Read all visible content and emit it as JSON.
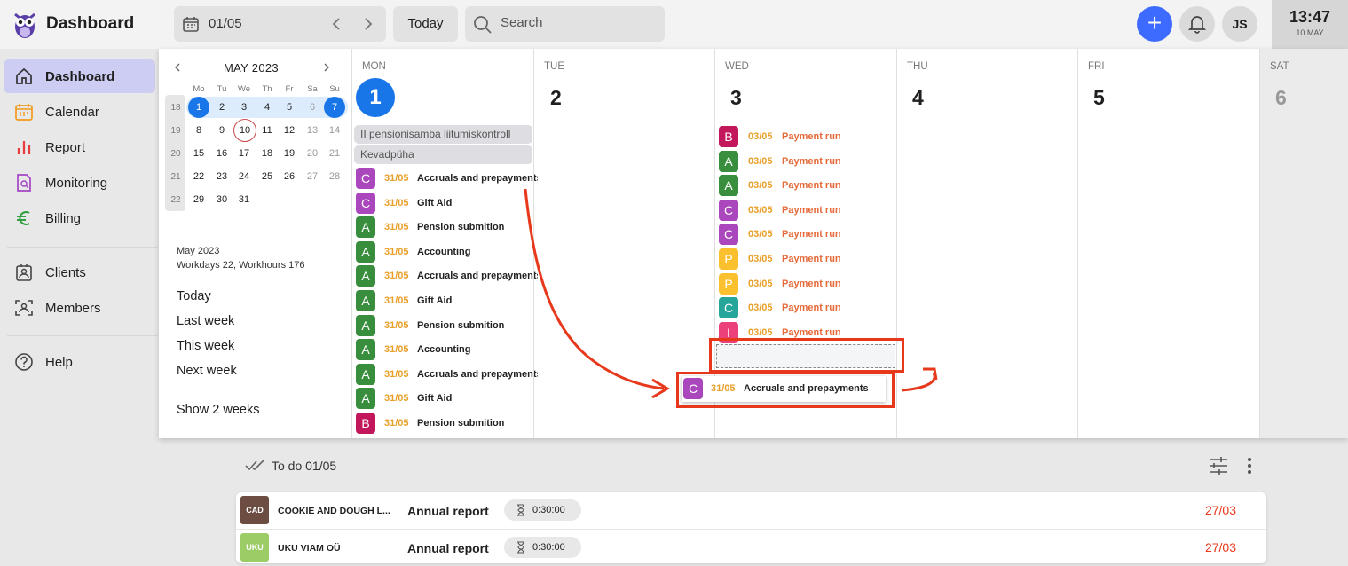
{
  "header": {
    "app_title": "Dashboard",
    "date_value": "01/05",
    "today_label": "Today",
    "search_placeholder": "Search",
    "avatar_initials": "JS",
    "clock_time": "13:47",
    "clock_date": "10 MAY"
  },
  "sidebar": {
    "items": [
      {
        "label": "Dashboard",
        "icon": "home-icon",
        "active": true
      },
      {
        "label": "Calendar",
        "icon": "calendar-icon"
      },
      {
        "label": "Report",
        "icon": "bar-chart-icon"
      },
      {
        "label": "Monitoring",
        "icon": "monitoring-doc-icon"
      },
      {
        "label": "Billing",
        "icon": "euro-icon"
      },
      {
        "label": "Clients",
        "icon": "clients-icon"
      },
      {
        "label": "Members",
        "icon": "members-icon"
      },
      {
        "label": "Help",
        "icon": "help-icon"
      }
    ]
  },
  "mini_calendar": {
    "title": "MAY 2023",
    "weekday_headers": [
      "Mo",
      "Tu",
      "We",
      "Th",
      "Fr",
      "Sa",
      "Su"
    ],
    "weeks": [
      {
        "week": "18",
        "days": [
          "1",
          "2",
          "3",
          "4",
          "5",
          "6",
          "7"
        ]
      },
      {
        "week": "19",
        "days": [
          "8",
          "9",
          "10",
          "11",
          "12",
          "13",
          "14"
        ]
      },
      {
        "week": "20",
        "days": [
          "15",
          "16",
          "17",
          "18",
          "19",
          "20",
          "21"
        ]
      },
      {
        "week": "21",
        "days": [
          "22",
          "23",
          "24",
          "25",
          "26",
          "27",
          "28"
        ]
      },
      {
        "week": "22",
        "days": [
          "29",
          "30",
          "31"
        ]
      }
    ],
    "summary_month": "May 2023",
    "summary_hours": "Workdays 22, Workhours 176",
    "quick_links": [
      "Today",
      "Last week",
      "This week",
      "Next week",
      "Show 2 weeks"
    ]
  },
  "week": {
    "days": [
      {
        "name": "MON",
        "num": "1"
      },
      {
        "name": "TUE",
        "num": "2"
      },
      {
        "name": "WED",
        "num": "3"
      },
      {
        "name": "THU",
        "num": "4"
      },
      {
        "name": "FRI",
        "num": "5"
      },
      {
        "name": "SAT",
        "num": "6"
      }
    ],
    "holidays": [
      "II pensionisamba liitumiskontroll",
      "Kevadpüha"
    ],
    "monday_tasks": [
      {
        "badge": "C",
        "color": "#ab47bc",
        "date": "31/05",
        "name": "Accruals and prepayments"
      },
      {
        "badge": "C",
        "color": "#ab47bc",
        "date": "31/05",
        "name": "Gift Aid"
      },
      {
        "badge": "A",
        "color": "#388e3c",
        "date": "31/05",
        "name": "Pension submition"
      },
      {
        "badge": "A",
        "color": "#388e3c",
        "date": "31/05",
        "name": "Accounting"
      },
      {
        "badge": "A",
        "color": "#388e3c",
        "date": "31/05",
        "name": "Accruals and prepayments"
      },
      {
        "badge": "A",
        "color": "#388e3c",
        "date": "31/05",
        "name": "Gift Aid"
      },
      {
        "badge": "A",
        "color": "#388e3c",
        "date": "31/05",
        "name": "Pension submition"
      },
      {
        "badge": "A",
        "color": "#388e3c",
        "date": "31/05",
        "name": "Accounting"
      },
      {
        "badge": "A",
        "color": "#388e3c",
        "date": "31/05",
        "name": "Accruals and prepayments"
      },
      {
        "badge": "A",
        "color": "#388e3c",
        "date": "31/05",
        "name": "Gift Aid"
      },
      {
        "badge": "B",
        "color": "#c2185b",
        "date": "31/05",
        "name": "Pension submition"
      }
    ],
    "wednesday_tasks": [
      {
        "badge": "B",
        "color": "#c2185b",
        "date": "03/05",
        "name": "Payment run"
      },
      {
        "badge": "A",
        "color": "#388e3c",
        "date": "03/05",
        "name": "Payment run"
      },
      {
        "badge": "A",
        "color": "#388e3c",
        "date": "03/05",
        "name": "Payment run"
      },
      {
        "badge": "C",
        "color": "#ab47bc",
        "date": "03/05",
        "name": "Payment run"
      },
      {
        "badge": "C",
        "color": "#ab47bc",
        "date": "03/05",
        "name": "Payment run"
      },
      {
        "badge": "P",
        "color": "#fbc02d",
        "date": "03/05",
        "name": "Payment run"
      },
      {
        "badge": "P",
        "color": "#fbc02d",
        "date": "03/05",
        "name": "Payment run"
      },
      {
        "badge": "C",
        "color": "#26a69a",
        "date": "03/05",
        "name": "Payment run"
      },
      {
        "badge": "I",
        "color": "#ec407a",
        "date": "03/05",
        "name": "Payment run"
      }
    ],
    "dragged_task": {
      "badge": "C",
      "color": "#ab47bc",
      "date": "31/05",
      "name": "Accruals and prepayments"
    }
  },
  "todo": {
    "title": "To do 01/05",
    "rows": [
      {
        "abbr": "CAD",
        "color": "#6d4c41",
        "client": "COOKIE AND DOUGH L...",
        "type": "Annual report",
        "time": "0:30:00",
        "due": "27/03"
      },
      {
        "abbr": "UKU",
        "color": "#9ccc65",
        "client": "UKU VIAM OÜ",
        "type": "Annual report",
        "time": "0:30:00",
        "due": "27/03"
      }
    ]
  },
  "colors": {
    "accent": "#3d6bff",
    "selected": "#1976e8",
    "highlight": "#e8381c"
  }
}
